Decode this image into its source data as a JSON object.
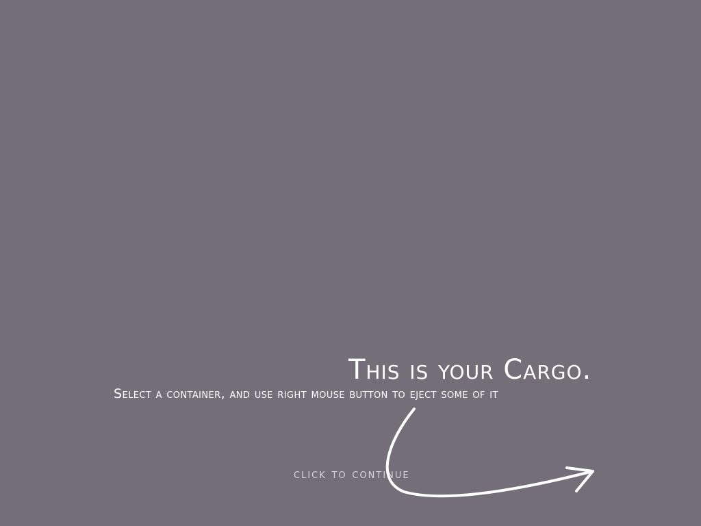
{
  "tutorial": {
    "title": "This is your Cargo.",
    "instruction": "Select a container, and use right mouse button to eject some of it",
    "continue_label": "click to continue"
  },
  "icons": {
    "arrow": "curved-arrow-right-icon"
  },
  "colors": {
    "background": "#736e78",
    "text": "#ffffff",
    "continue_text": "#d6d3d8"
  }
}
